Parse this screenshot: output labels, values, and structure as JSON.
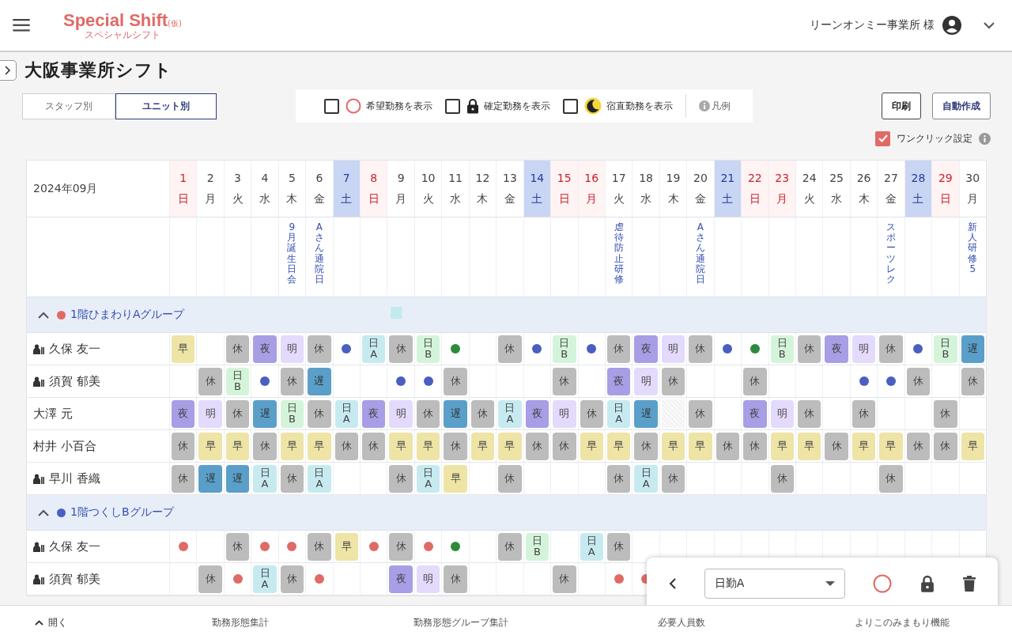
{
  "header": {
    "logo": "Special Shift",
    "logo_suffix": "(仮)",
    "logo_sub": "スペシャルシフト",
    "user": "リーンオンミー事業所 様"
  },
  "page": {
    "title": "大阪事業所シフト"
  },
  "view_tabs": [
    {
      "label": "スタッフ別",
      "selected": false
    },
    {
      "label": "ユニット別",
      "selected": true
    }
  ],
  "filters": [
    {
      "kind": "wish",
      "label": "希望勤務を表示",
      "checked": false
    },
    {
      "kind": "lock",
      "label": "確定勤務を表示",
      "checked": false
    },
    {
      "kind": "night",
      "label": "宿直勤務を表示",
      "checked": false
    }
  ],
  "legend": "凡例",
  "actions": [
    "印刷",
    "自動作成"
  ],
  "one_click": {
    "label": "ワンクリック設定",
    "checked": true
  },
  "table": {
    "month": "2024年09月",
    "days": [
      {
        "date": "1",
        "weekday": "日",
        "kind": "holiday"
      },
      {
        "date": "2",
        "weekday": "月",
        "kind": "weekday"
      },
      {
        "date": "3",
        "weekday": "火",
        "kind": "weekday"
      },
      {
        "date": "4",
        "weekday": "水",
        "kind": "weekday"
      },
      {
        "date": "5",
        "weekday": "木",
        "kind": "weekday",
        "event": "9月誕生日会"
      },
      {
        "date": "6",
        "weekday": "金",
        "kind": "weekday",
        "event": "Aさん通院日"
      },
      {
        "date": "7",
        "weekday": "土",
        "kind": "saturday"
      },
      {
        "date": "8",
        "weekday": "日",
        "kind": "holiday"
      },
      {
        "date": "9",
        "weekday": "月",
        "kind": "weekday"
      },
      {
        "date": "10",
        "weekday": "火",
        "kind": "weekday"
      },
      {
        "date": "11",
        "weekday": "水",
        "kind": "weekday"
      },
      {
        "date": "12",
        "weekday": "木",
        "kind": "weekday"
      },
      {
        "date": "13",
        "weekday": "金",
        "kind": "weekday"
      },
      {
        "date": "14",
        "weekday": "土",
        "kind": "saturday"
      },
      {
        "date": "15",
        "weekday": "日",
        "kind": "holiday"
      },
      {
        "date": "16",
        "weekday": "月",
        "kind": "holiday"
      },
      {
        "date": "17",
        "weekday": "火",
        "kind": "weekday",
        "event": "虐待防止研修"
      },
      {
        "date": "18",
        "weekday": "水",
        "kind": "weekday"
      },
      {
        "date": "19",
        "weekday": "木",
        "kind": "weekday"
      },
      {
        "date": "20",
        "weekday": "金",
        "kind": "weekday",
        "event": "Aさん通院日"
      },
      {
        "date": "21",
        "weekday": "土",
        "kind": "saturday"
      },
      {
        "date": "22",
        "weekday": "日",
        "kind": "holiday"
      },
      {
        "date": "23",
        "weekday": "月",
        "kind": "holiday"
      },
      {
        "date": "24",
        "weekday": "火",
        "kind": "weekday"
      },
      {
        "date": "25",
        "weekday": "水",
        "kind": "weekday"
      },
      {
        "date": "26",
        "weekday": "木",
        "kind": "weekday"
      },
      {
        "date": "27",
        "weekday": "金",
        "kind": "weekday",
        "event": "スポーツレク"
      },
      {
        "date": "28",
        "weekday": "土",
        "kind": "saturday"
      },
      {
        "date": "29",
        "weekday": "日",
        "kind": "holiday"
      },
      {
        "date": "30",
        "weekday": "月",
        "kind": "weekday",
        "event": "新人研修5"
      }
    ],
    "groups": [
      {
        "name": "1階ひまわりAグループ",
        "color": "#e06a66",
        "expanded": true,
        "rows": [
          {
            "name": "久保 友一",
            "badge": true,
            "cells": [
              {
                "kind": "shift",
                "label": "早",
                "color": "#ede4a6"
              },
              {
                "kind": "empty"
              },
              {
                "kind": "shift",
                "label": "休",
                "color": "#bcbcbc"
              },
              {
                "kind": "shift",
                "label": "夜",
                "color": "#a79ee5"
              },
              {
                "kind": "shift",
                "label": "明",
                "color": "#e4dafc"
              },
              {
                "kind": "shift",
                "label": "休",
                "color": "#bcbcbc"
              },
              {
                "kind": "dot",
                "color": "#4a5fc1"
              },
              {
                "kind": "shift",
                "label": "日A",
                "color": "#c6eaf0"
              },
              {
                "kind": "shift",
                "label": "休",
                "color": "#bcbcbc"
              },
              {
                "kind": "shift",
                "label": "日B",
                "color": "#d4f4d9"
              },
              {
                "kind": "dot",
                "color": "#2e8b3e"
              },
              {
                "kind": "empty"
              },
              {
                "kind": "shift",
                "label": "休",
                "color": "#bcbcbc"
              },
              {
                "kind": "dot",
                "color": "#4a5fc1"
              },
              {
                "kind": "shift",
                "label": "日B",
                "color": "#d4f4d9"
              },
              {
                "kind": "dot",
                "color": "#4a5fc1"
              },
              {
                "kind": "shift",
                "label": "休",
                "color": "#bcbcbc"
              },
              {
                "kind": "shift",
                "label": "夜",
                "color": "#a79ee5"
              },
              {
                "kind": "shift",
                "label": "明",
                "color": "#e4dafc"
              },
              {
                "kind": "shift",
                "label": "休",
                "color": "#bcbcbc"
              },
              {
                "kind": "dot",
                "color": "#4a5fc1"
              },
              {
                "kind": "dot",
                "color": "#2e8b3e"
              },
              {
                "kind": "shift",
                "label": "日B",
                "color": "#d4f4d9"
              },
              {
                "kind": "shift",
                "label": "休",
                "color": "#bcbcbc"
              },
              {
                "kind": "shift",
                "label": "夜",
                "color": "#a79ee5"
              },
              {
                "kind": "shift",
                "label": "明",
                "color": "#e4dafc"
              },
              {
                "kind": "shift",
                "label": "休",
                "color": "#bcbcbc"
              },
              {
                "kind": "dot",
                "color": "#4a5fc1"
              },
              {
                "kind": "shift",
                "label": "日B",
                "color": "#d4f4d9"
              },
              {
                "kind": "shift",
                "label": "遅",
                "color": "#5a9fc9"
              }
            ]
          },
          {
            "name": "須賀 郁美",
            "badge": true,
            "cells": [
              {
                "kind": "empty"
              },
              {
                "kind": "shift",
                "label": "休",
                "color": "#bcbcbc"
              },
              {
                "kind": "shift",
                "label": "日B",
                "color": "#d4f4d9"
              },
              {
                "kind": "dot",
                "color": "#4a5fc1"
              },
              {
                "kind": "shift",
                "label": "休",
                "color": "#bcbcbc"
              },
              {
                "kind": "shift",
                "label": "遅",
                "color": "#5a9fc9"
              },
              {
                "kind": "empty"
              },
              {
                "kind": "empty"
              },
              {
                "kind": "dot",
                "color": "#4a5fc1"
              },
              {
                "kind": "dot",
                "color": "#4a5fc1"
              },
              {
                "kind": "shift",
                "label": "休",
                "color": "#bcbcbc"
              },
              {
                "kind": "empty"
              },
              {
                "kind": "empty"
              },
              {
                "kind": "empty"
              },
              {
                "kind": "shift",
                "label": "休",
                "color": "#bcbcbc"
              },
              {
                "kind": "empty"
              },
              {
                "kind": "shift",
                "label": "夜",
                "color": "#a79ee5"
              },
              {
                "kind": "shift",
                "label": "明",
                "color": "#e4dafc"
              },
              {
                "kind": "shift",
                "label": "休",
                "color": "#bcbcbc"
              },
              {
                "kind": "empty"
              },
              {
                "kind": "empty"
              },
              {
                "kind": "shift",
                "label": "休",
                "color": "#bcbcbc"
              },
              {
                "kind": "empty"
              },
              {
                "kind": "empty"
              },
              {
                "kind": "empty"
              },
              {
                "kind": "dot",
                "color": "#4a5fc1"
              },
              {
                "kind": "dot",
                "color": "#4a5fc1"
              },
              {
                "kind": "shift",
                "label": "休",
                "color": "#bcbcbc"
              },
              {
                "kind": "empty"
              },
              {
                "kind": "shift",
                "label": "休",
                "color": "#bcbcbc"
              }
            ]
          },
          {
            "name": "大澤 元",
            "badge": false,
            "cells": [
              {
                "kind": "shift",
                "label": "夜",
                "color": "#a79ee5"
              },
              {
                "kind": "shift",
                "label": "明",
                "color": "#e4dafc"
              },
              {
                "kind": "shift",
                "label": "休",
                "color": "#bcbcbc"
              },
              {
                "kind": "shift",
                "label": "遅",
                "color": "#5a9fc9"
              },
              {
                "kind": "shift",
                "label": "日B",
                "color": "#d4f4d9"
              },
              {
                "kind": "shift",
                "label": "休",
                "color": "#bcbcbc"
              },
              {
                "kind": "shift",
                "label": "日A",
                "color": "#c6eaf0"
              },
              {
                "kind": "shift",
                "label": "夜",
                "color": "#a79ee5"
              },
              {
                "kind": "shift",
                "label": "明",
                "color": "#e4dafc"
              },
              {
                "kind": "shift",
                "label": "休",
                "color": "#bcbcbc"
              },
              {
                "kind": "shift",
                "label": "遅",
                "color": "#5a9fc9"
              },
              {
                "kind": "shift",
                "label": "休",
                "color": "#bcbcbc"
              },
              {
                "kind": "shift",
                "label": "日A",
                "color": "#c6eaf0"
              },
              {
                "kind": "shift",
                "label": "夜",
                "color": "#a79ee5"
              },
              {
                "kind": "shift",
                "label": "明",
                "color": "#e4dafc"
              },
              {
                "kind": "shift",
                "label": "休",
                "color": "#bcbcbc"
              },
              {
                "kind": "shift",
                "label": "日A",
                "color": "#c6eaf0"
              },
              {
                "kind": "shift",
                "label": "遅",
                "color": "#5a9fc9"
              },
              {
                "kind": "hatched"
              },
              {
                "kind": "shift",
                "label": "休",
                "color": "#bcbcbc"
              },
              {
                "kind": "empty"
              },
              {
                "kind": "shift",
                "label": "夜",
                "color": "#a79ee5"
              },
              {
                "kind": "shift",
                "label": "明",
                "color": "#e4dafc"
              },
              {
                "kind": "shift",
                "label": "休",
                "color": "#bcbcbc"
              },
              {
                "kind": "empty"
              },
              {
                "kind": "shift",
                "label": "休",
                "color": "#bcbcbc"
              },
              {
                "kind": "empty"
              },
              {
                "kind": "empty"
              },
              {
                "kind": "shift",
                "label": "休",
                "color": "#bcbcbc"
              },
              {
                "kind": "empty"
              }
            ]
          },
          {
            "name": "村井 小百合",
            "badge": false,
            "cells": [
              {
                "kind": "shift",
                "label": "休",
                "color": "#bcbcbc"
              },
              {
                "kind": "shift",
                "label": "早",
                "color": "#ede4a6"
              },
              {
                "kind": "shift",
                "label": "早",
                "color": "#ede4a6"
              },
              {
                "kind": "shift",
                "label": "休",
                "color": "#bcbcbc"
              },
              {
                "kind": "shift",
                "label": "早",
                "color": "#ede4a6"
              },
              {
                "kind": "shift",
                "label": "早",
                "color": "#ede4a6"
              },
              {
                "kind": "shift",
                "label": "休",
                "color": "#bcbcbc"
              },
              {
                "kind": "shift",
                "label": "休",
                "color": "#bcbcbc"
              },
              {
                "kind": "shift",
                "label": "早",
                "color": "#ede4a6"
              },
              {
                "kind": "shift",
                "label": "早",
                "color": "#ede4a6"
              },
              {
                "kind": "shift",
                "label": "休",
                "color": "#bcbcbc"
              },
              {
                "kind": "shift",
                "label": "早",
                "color": "#ede4a6"
              },
              {
                "kind": "shift",
                "label": "早",
                "color": "#ede4a6"
              },
              {
                "kind": "shift",
                "label": "休",
                "color": "#bcbcbc"
              },
              {
                "kind": "shift",
                "label": "休",
                "color": "#bcbcbc"
              },
              {
                "kind": "shift",
                "label": "早",
                "color": "#ede4a6"
              },
              {
                "kind": "shift",
                "label": "早",
                "color": "#ede4a6"
              },
              {
                "kind": "shift",
                "label": "休",
                "color": "#bcbcbc"
              },
              {
                "kind": "shift",
                "label": "早",
                "color": "#ede4a6"
              },
              {
                "kind": "shift",
                "label": "早",
                "color": "#ede4a6"
              },
              {
                "kind": "shift",
                "label": "休",
                "color": "#bcbcbc"
              },
              {
                "kind": "shift",
                "label": "休",
                "color": "#bcbcbc"
              },
              {
                "kind": "shift",
                "label": "早",
                "color": "#ede4a6"
              },
              {
                "kind": "shift",
                "label": "早",
                "color": "#ede4a6"
              },
              {
                "kind": "shift",
                "label": "休",
                "color": "#bcbcbc"
              },
              {
                "kind": "shift",
                "label": "早",
                "color": "#ede4a6"
              },
              {
                "kind": "shift",
                "label": "早",
                "color": "#ede4a6"
              },
              {
                "kind": "shift",
                "label": "休",
                "color": "#bcbcbc"
              },
              {
                "kind": "shift",
                "label": "休",
                "color": "#bcbcbc"
              },
              {
                "kind": "shift",
                "label": "早",
                "color": "#ede4a6"
              }
            ]
          },
          {
            "name": "早川 香織",
            "badge": true,
            "cells": [
              {
                "kind": "shift",
                "label": "休",
                "color": "#bcbcbc"
              },
              {
                "kind": "shift",
                "label": "遅",
                "color": "#5a9fc9"
              },
              {
                "kind": "shift",
                "label": "遅",
                "color": "#5a9fc9"
              },
              {
                "kind": "shift",
                "label": "日A",
                "color": "#c6eaf0"
              },
              {
                "kind": "shift",
                "label": "休",
                "color": "#bcbcbc"
              },
              {
                "kind": "shift",
                "label": "日A",
                "color": "#c6eaf0"
              },
              {
                "kind": "empty"
              },
              {
                "kind": "empty"
              },
              {
                "kind": "shift",
                "label": "休",
                "color": "#bcbcbc"
              },
              {
                "kind": "shift",
                "label": "日A",
                "color": "#c6eaf0"
              },
              {
                "kind": "shift",
                "label": "早",
                "color": "#ede4a6"
              },
              {
                "kind": "empty"
              },
              {
                "kind": "shift",
                "label": "休",
                "color": "#bcbcbc"
              },
              {
                "kind": "empty"
              },
              {
                "kind": "empty"
              },
              {
                "kind": "empty"
              },
              {
                "kind": "shift",
                "label": "休",
                "color": "#bcbcbc"
              },
              {
                "kind": "shift",
                "label": "日A",
                "color": "#c6eaf0"
              },
              {
                "kind": "shift",
                "label": "休",
                "color": "#bcbcbc"
              },
              {
                "kind": "empty"
              },
              {
                "kind": "empty"
              },
              {
                "kind": "empty"
              },
              {
                "kind": "shift",
                "label": "休",
                "color": "#bcbcbc"
              },
              {
                "kind": "empty"
              },
              {
                "kind": "empty"
              },
              {
                "kind": "empty"
              },
              {
                "kind": "shift",
                "label": "休",
                "color": "#bcbcbc"
              },
              {
                "kind": "empty"
              },
              {
                "kind": "empty"
              },
              {
                "kind": "empty"
              }
            ]
          }
        ]
      },
      {
        "name": "1階つくしBグループ",
        "color": "#4a5fc1",
        "expanded": true,
        "rows": [
          {
            "name": "久保 友一",
            "badge": true,
            "cells": [
              {
                "kind": "dot",
                "color": "#e06a66"
              },
              {
                "kind": "empty"
              },
              {
                "kind": "shift",
                "label": "休",
                "color": "#bcbcbc"
              },
              {
                "kind": "dot",
                "color": "#e06a66"
              },
              {
                "kind": "dot",
                "color": "#e06a66"
              },
              {
                "kind": "shift",
                "label": "休",
                "color": "#bcbcbc"
              },
              {
                "kind": "shift",
                "label": "早",
                "color": "#ede4a6"
              },
              {
                "kind": "dot",
                "color": "#e06a66"
              },
              {
                "kind": "shift",
                "label": "休",
                "color": "#bcbcbc"
              },
              {
                "kind": "dot",
                "color": "#e06a66"
              },
              {
                "kind": "dot",
                "color": "#2e8b3e"
              },
              {
                "kind": "empty"
              },
              {
                "kind": "shift",
                "label": "休",
                "color": "#bcbcbc"
              },
              {
                "kind": "shift",
                "label": "日B",
                "color": "#d4f4d9"
              },
              {
                "kind": "empty"
              },
              {
                "kind": "shift",
                "label": "日A",
                "color": "#c6eaf0"
              },
              {
                "kind": "shift",
                "label": "休",
                "color": "#bcbcbc"
              }
            ]
          },
          {
            "name": "須賀 郁美",
            "badge": true,
            "cells": [
              {
                "kind": "empty"
              },
              {
                "kind": "shift",
                "label": "休",
                "color": "#bcbcbc"
              },
              {
                "kind": "dot",
                "color": "#e06a66"
              },
              {
                "kind": "shift",
                "label": "日A",
                "color": "#c6eaf0"
              },
              {
                "kind": "shift",
                "label": "休",
                "color": "#bcbcbc"
              },
              {
                "kind": "dot",
                "color": "#e06a66"
              },
              {
                "kind": "empty"
              },
              {
                "kind": "empty"
              },
              {
                "kind": "shift",
                "label": "夜",
                "color": "#a79ee5"
              },
              {
                "kind": "shift",
                "label": "明",
                "color": "#e4dafc"
              },
              {
                "kind": "shift",
                "label": "休",
                "color": "#bcbcbc"
              },
              {
                "kind": "empty"
              },
              {
                "kind": "empty"
              },
              {
                "kind": "empty"
              },
              {
                "kind": "shift",
                "label": "休",
                "color": "#bcbcbc"
              },
              {
                "kind": "empty"
              },
              {
                "kind": "dot",
                "color": "#e06a66"
              },
              {
                "kind": "dot",
                "color": "#e06a66"
              }
            ]
          }
        ]
      }
    ]
  },
  "quick_panel": {
    "select": "日勤A"
  },
  "bottom_bar": {
    "toggle": "開く",
    "items": [
      "勤務形態集計",
      "勤務形態グループ集計",
      "必要人員数",
      "よりこのみまもり機能"
    ]
  }
}
